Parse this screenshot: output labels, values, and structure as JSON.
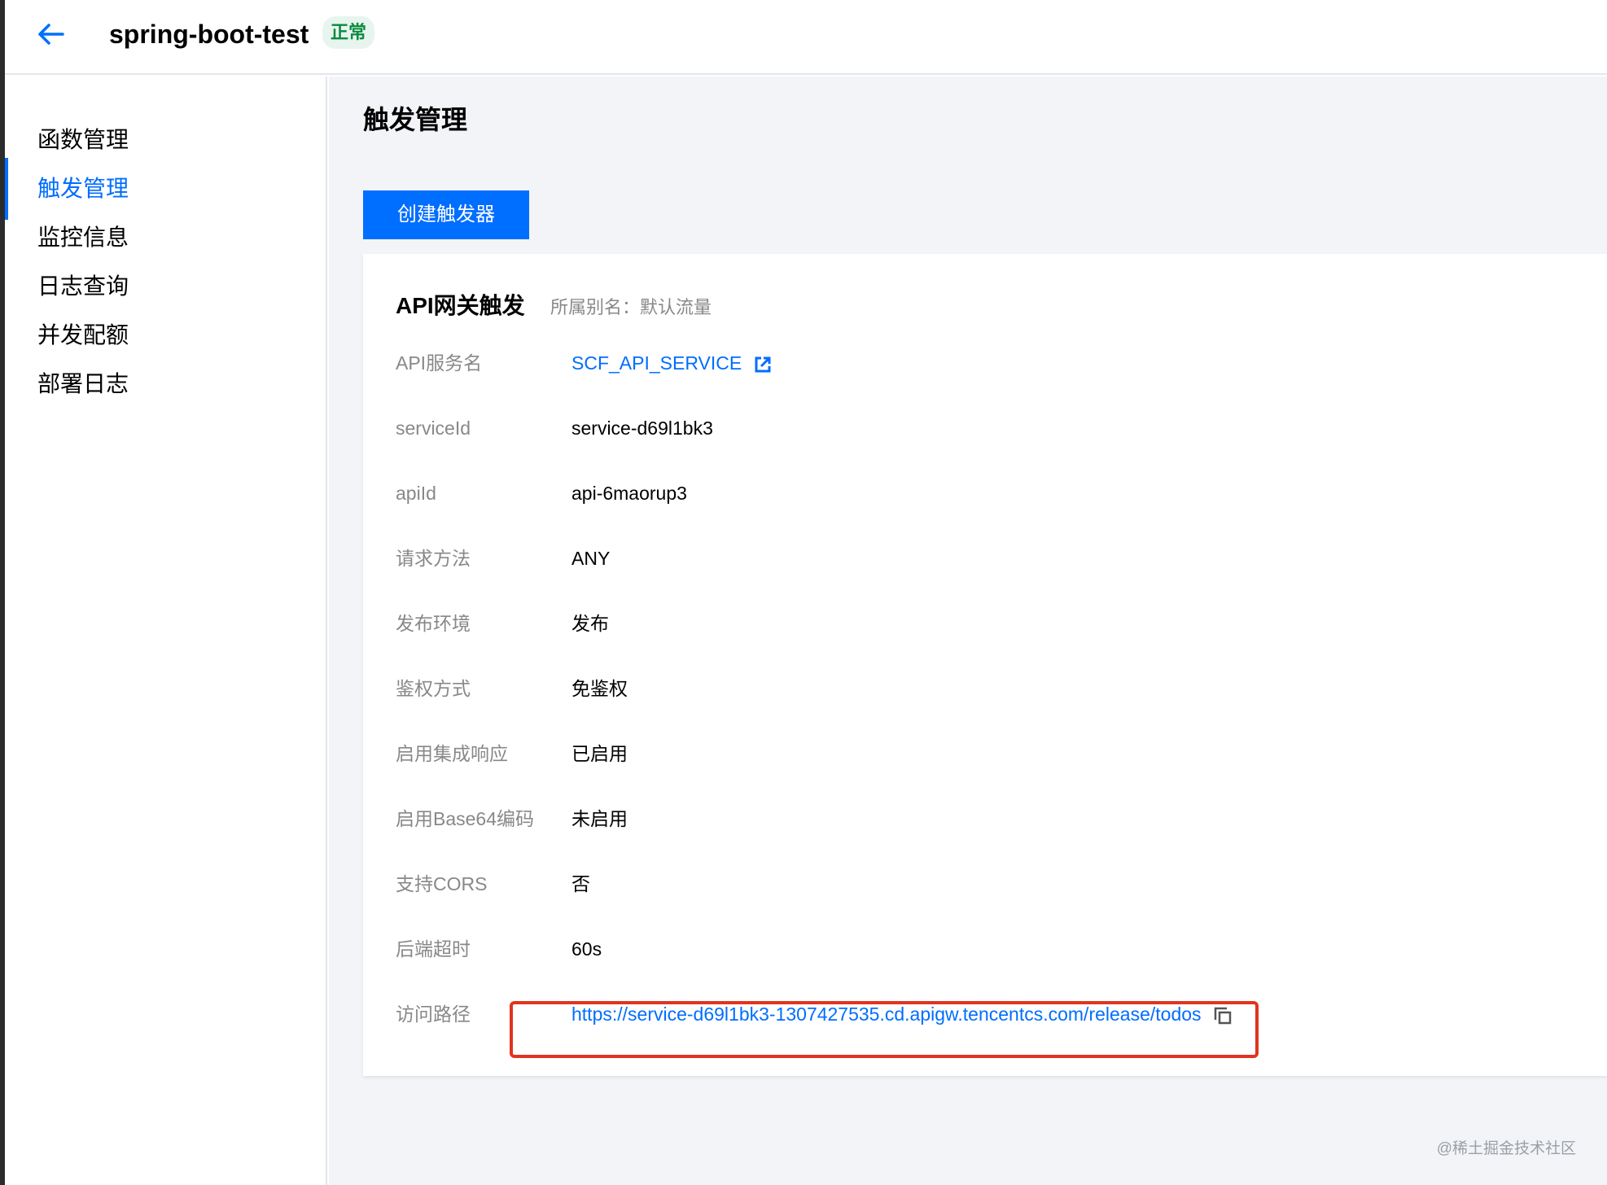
{
  "header": {
    "title": "spring-boot-test",
    "status": "正常",
    "back_icon": "arrow-left-icon"
  },
  "sidebar": {
    "items": [
      {
        "label": "函数管理",
        "active": false
      },
      {
        "label": "触发管理",
        "active": true
      },
      {
        "label": "监控信息",
        "active": false
      },
      {
        "label": "日志查询",
        "active": false
      },
      {
        "label": "并发配额",
        "active": false
      },
      {
        "label": "部署日志",
        "active": false
      }
    ]
  },
  "main": {
    "title": "触发管理",
    "create_button": "创建触发器",
    "card": {
      "title": "API网关触发",
      "subtitle": "所属别名：默认流量",
      "fields": [
        {
          "label": "API服务名",
          "value": "SCF_API_SERVICE"
        },
        {
          "label": "serviceId",
          "value": "service-d69l1bk3"
        },
        {
          "label": "apiId",
          "value": "api-6maorup3"
        },
        {
          "label": "请求方法",
          "value": "ANY"
        },
        {
          "label": "发布环境",
          "value": "发布"
        },
        {
          "label": "鉴权方式",
          "value": "免鉴权"
        },
        {
          "label": "启用集成响应",
          "value": "已启用"
        },
        {
          "label": "启用Base64编码",
          "value": "未启用"
        },
        {
          "label": "支持CORS",
          "value": "否"
        },
        {
          "label": "后端超时",
          "value": "60s"
        },
        {
          "label": "访问路径",
          "value": "https://service-d69l1bk3-1307427535.cd.apigw.tencentcs.com/release/todos"
        }
      ]
    }
  },
  "watermark": "@稀土掘金技术社区",
  "colors": {
    "accent": "#006eff",
    "status_green": "#0a8a3f",
    "highlight_red": "#e0341f"
  }
}
